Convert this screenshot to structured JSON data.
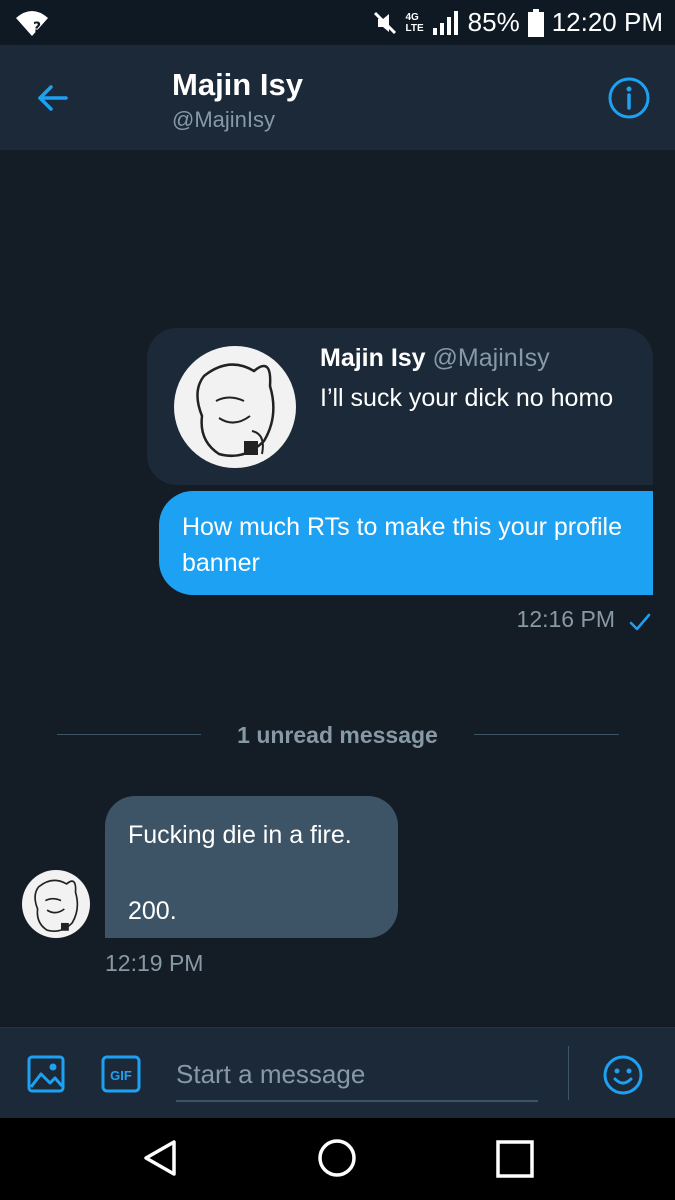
{
  "status_bar": {
    "battery": "85%",
    "time": "12:20 PM",
    "network": "4G",
    "network_sub": "LTE"
  },
  "header": {
    "title": "Majin Isy",
    "handle": "@MajinIsy",
    "icons": {
      "back": "arrow-left-icon",
      "info": "info-circle-icon"
    }
  },
  "conversation": {
    "quoted_tweet": {
      "author": "Majin Isy",
      "handle": "@MajinIsy",
      "text": "I’ll suck your dick no homo"
    },
    "sent_message": {
      "text": "How much RTs to make this your profile banner",
      "time": "12:16 PM",
      "status_icon": "check-icon"
    },
    "unread_divider": "1 unread message",
    "received_message": {
      "text": "Fucking die in a fire.\n\n200.",
      "time": "12:19 PM"
    }
  },
  "composer": {
    "placeholder": "Start a message",
    "gif_label": "GIF",
    "icons": {
      "media": "image-icon",
      "emoji": "smiley-icon"
    }
  },
  "nav": {
    "icons": {
      "back": "triangle-back-icon",
      "home": "circle-home-icon",
      "recents": "square-recents-icon"
    }
  },
  "colors": {
    "background": "#141d26",
    "header": "#1c2938",
    "accent": "#1da1f2",
    "received_bubble": "#3d5466",
    "muted_text": "#8899a6"
  }
}
